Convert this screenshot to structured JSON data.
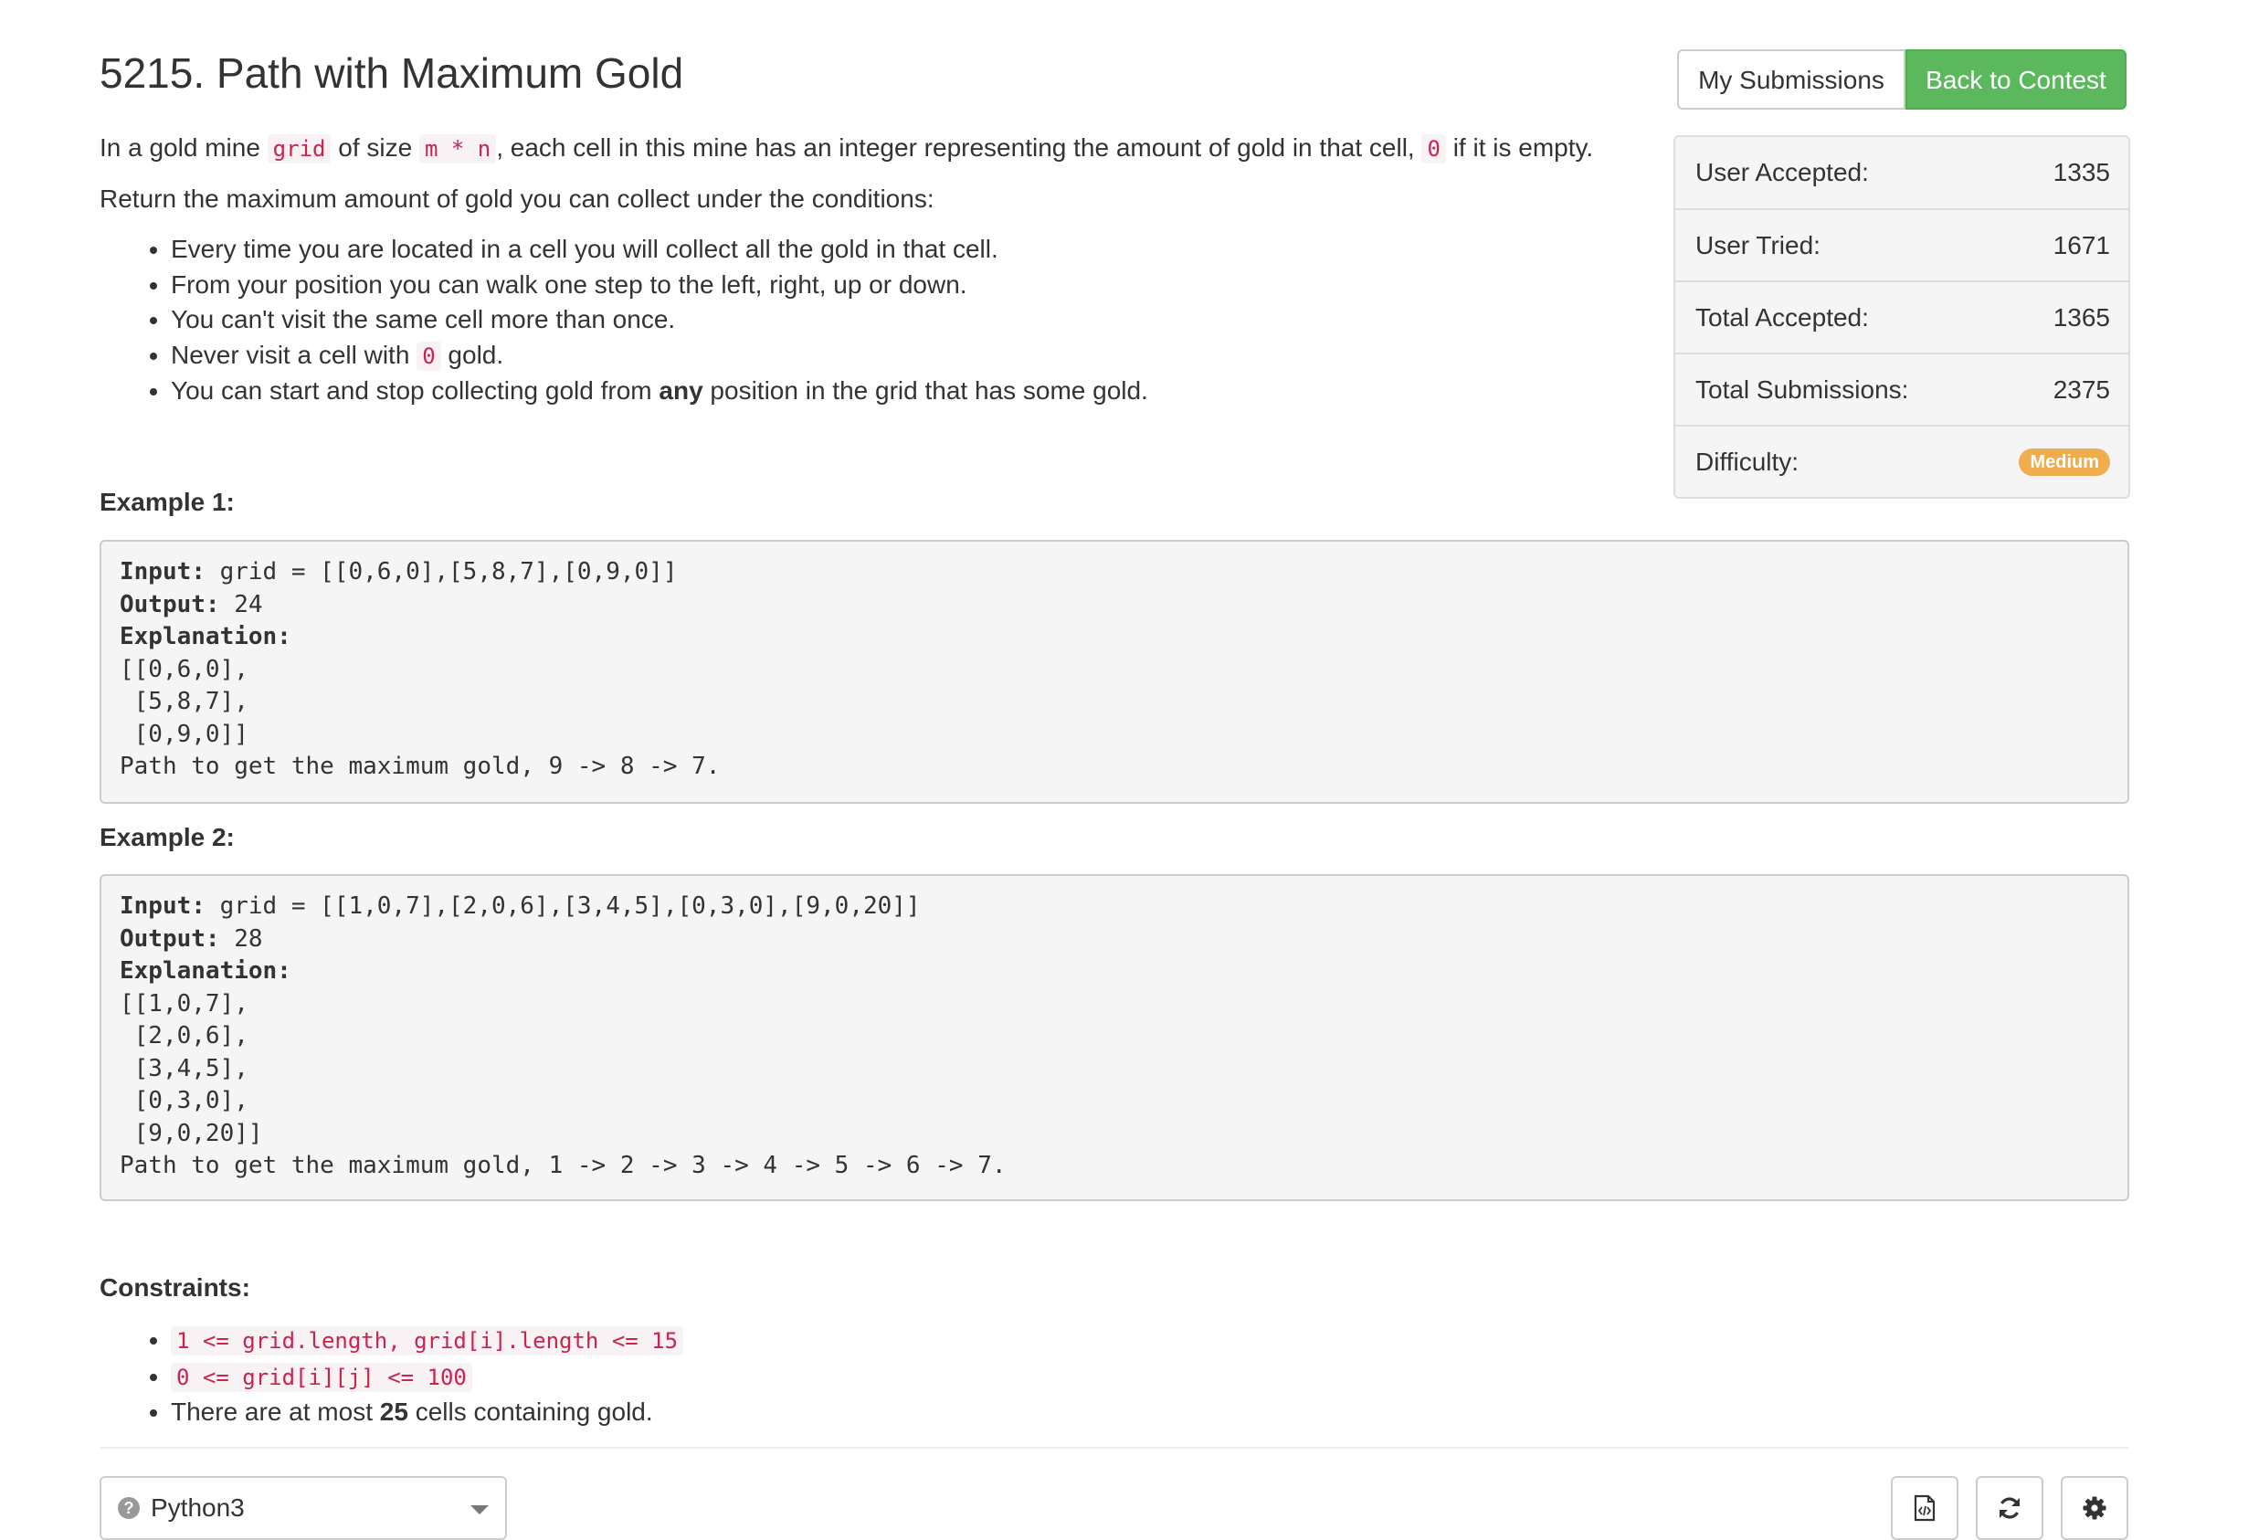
{
  "problem": {
    "title": "5215. Path with Maximum Gold",
    "intro": {
      "t1": "In a gold mine ",
      "c1": "grid",
      "t2": " of size ",
      "c2": "m * n",
      "t3": ", each cell in this mine has an integer representing the amount of gold in that cell, ",
      "c3": "0",
      "t4": " if it is empty."
    },
    "return_text": "Return the maximum amount of gold you can collect under the conditions:",
    "rules": {
      "r1": "Every time you are located in a cell you will collect all the gold in that cell.",
      "r2": "From your position you can walk one step to the left, right, up or down.",
      "r3": "You can't visit the same cell more than once.",
      "r4a": "Never visit a cell with ",
      "r4c": "0",
      "r4b": " gold.",
      "r5a": "You can start and stop collecting gold from ",
      "r5b": "any",
      "r5c": " position in the grid that has some gold."
    }
  },
  "buttons": {
    "my_submissions": "My Submissions",
    "back_to_contest": "Back to Contest"
  },
  "stats": {
    "user_accepted_label": "User Accepted:",
    "user_accepted": "1335",
    "user_tried_label": "User Tried:",
    "user_tried": "1671",
    "total_accepted_label": "Total Accepted:",
    "total_accepted": "1365",
    "total_submissions_label": "Total Submissions:",
    "total_submissions": "2375",
    "difficulty_label": "Difficulty:",
    "difficulty": "Medium",
    "difficulty_color": "#f0ad4e"
  },
  "examples": {
    "ex1": {
      "heading": "Example 1:",
      "input_label": "Input:",
      "input_value": " grid = [[0,6,0],[5,8,7],[0,9,0]]",
      "output_label": "Output:",
      "output_value": " 24",
      "explanation_label": "Explanation:",
      "body": "[[0,6,0],\n [5,8,7],\n [0,9,0]]\nPath to get the maximum gold, 9 -> 8 -> 7."
    },
    "ex2": {
      "heading": "Example 2:",
      "input_label": "Input:",
      "input_value": " grid = [[1,0,7],[2,0,6],[3,4,5],[0,3,0],[9,0,20]]",
      "output_label": "Output:",
      "output_value": " 28",
      "explanation_label": "Explanation:",
      "body": "[[1,0,7],\n [2,0,6],\n [3,4,5],\n [0,3,0],\n [9,0,20]]\nPath to get the maximum gold, 1 -> 2 -> 3 -> 4 -> 5 -> 6 -> 7."
    }
  },
  "constraints": {
    "heading": "Constraints:",
    "c1": "1 <= grid.length, grid[i].length <= 15",
    "c2": "0 <= grid[i][j] <= 100",
    "c3a": "There are at most ",
    "c3b": "25",
    "c3c": " cells containing gold."
  },
  "editor": {
    "language": "Python3",
    "help_icon_glyph": "?"
  },
  "colors": {
    "accent_green": "#5cb85c",
    "code_red": "#c7254e"
  }
}
